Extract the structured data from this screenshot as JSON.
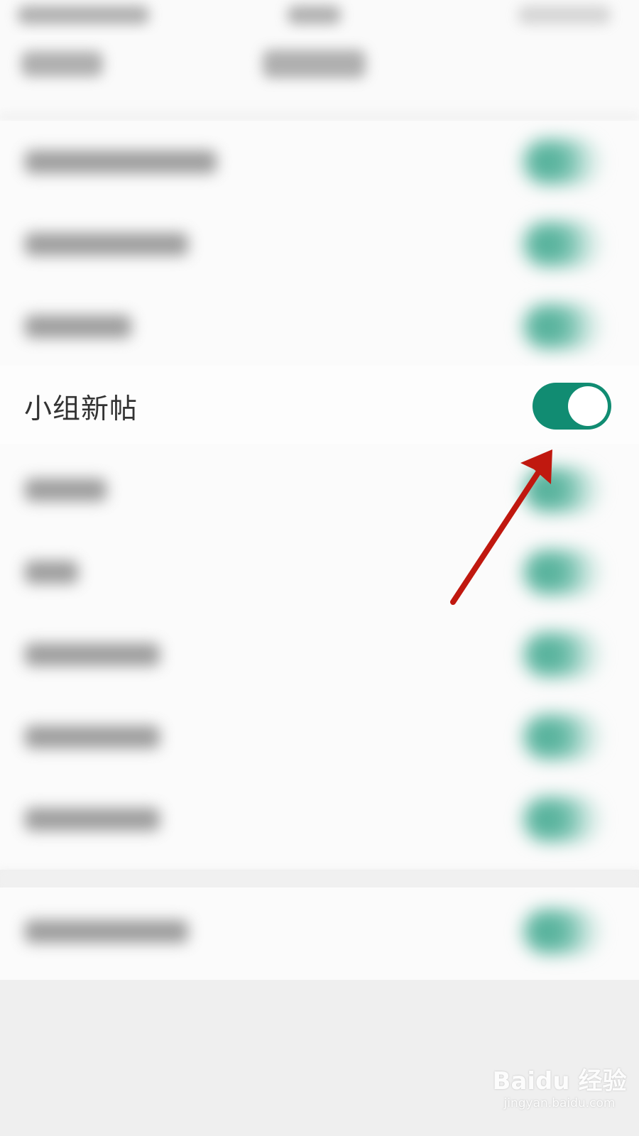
{
  "settings_item": {
    "label": "小组新帖",
    "enabled": true
  },
  "colors": {
    "accent": "#118c72",
    "annotation_arrow": "#c0180f",
    "background": "#efefef"
  },
  "watermark": {
    "logo": "Baidu 经验",
    "url": "jingyan.baidu.com"
  }
}
